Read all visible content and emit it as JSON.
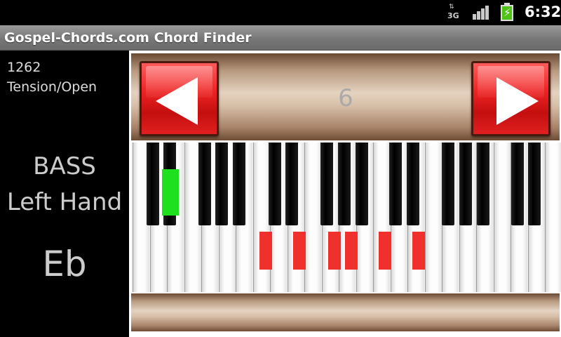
{
  "status_bar": {
    "network_label": "3G",
    "network_icon": "data-arrows-icon",
    "signal_icon": "signal-bars-icon",
    "battery_icon": "battery-charging-icon",
    "time": "6:32"
  },
  "app": {
    "title": "Gospel-Chords.com Chord Finder"
  },
  "chord_info": {
    "number": "1262",
    "voicing": "Tension/Open",
    "bass_label": "BASS",
    "hand_label": "Left Hand",
    "bass_note": "Eb"
  },
  "navigator": {
    "prev_icon": "arrow-left-icon",
    "next_icon": "arrow-right-icon",
    "current": "6"
  },
  "colors": {
    "bass_marker": "#1fe01f",
    "chord_marker": "#f0302c",
    "button": "#e62222"
  }
}
